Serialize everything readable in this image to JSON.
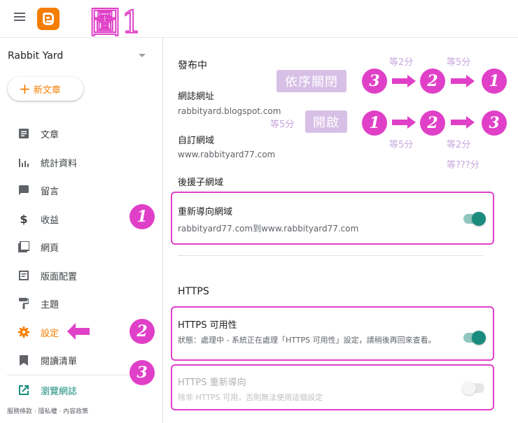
{
  "header": {
    "figure_label": "圖1"
  },
  "sidebar": {
    "blog_name": "Rabbit Yard",
    "new_post": "新文章",
    "items": [
      {
        "label": "文章",
        "icon": "posts-icon"
      },
      {
        "label": "統計資料",
        "icon": "stats-icon"
      },
      {
        "label": "留言",
        "icon": "comments-icon"
      },
      {
        "label": "收益",
        "icon": "earnings-icon"
      },
      {
        "label": "網頁",
        "icon": "pages-icon"
      },
      {
        "label": "版面配置",
        "icon": "layout-icon"
      },
      {
        "label": "主題",
        "icon": "theme-icon"
      },
      {
        "label": "設定",
        "icon": "gear-icon",
        "active": true
      },
      {
        "label": "閱讀清單",
        "icon": "bookmark-icon"
      }
    ],
    "view_blog": "瀏覽網誌",
    "footer": "服務條款 · 隱私權 · 內容政策"
  },
  "main": {
    "publishing": {
      "title": "發布中",
      "blog_address_label": "網誌網址",
      "blog_address_value": "rabbityard.blogspot.com",
      "custom_domain_label": "自訂網域",
      "custom_domain_value": "www.rabbityard77.com",
      "fallback_label": "後援子網域",
      "redirect_label": "重新導向網域",
      "redirect_value": "rabbityard77.com到www.rabbityard77.com",
      "redirect_on": true
    },
    "https": {
      "title": "HTTPS",
      "availability_label": "HTTPS 可用性",
      "availability_status": "狀態：處理中 - 系統正在處理「HTTPS 可用性」設定，請稍後再回來查看。",
      "availability_on": true,
      "redirect_label": "HTTPS 重新導向",
      "redirect_desc": "除非 HTTPS 可用，否則無法使用這個設定",
      "redirect_on": false
    }
  },
  "annotations": {
    "close_order_label": "依序關閉",
    "open_label": "開啟",
    "wait_2": "等2分",
    "wait_5a": "等5分",
    "wait_5b": "等5分",
    "wait_5c": "等5分",
    "wait_2b": "等2分",
    "wait_unknown": "等???分",
    "num1": "1",
    "num2": "2",
    "num3": "3"
  },
  "colors": {
    "accent": "#f57d00",
    "highlight": "#e040c8",
    "toggle_on": "#1a8c7d",
    "tag_bg": "#d7bfe6"
  }
}
